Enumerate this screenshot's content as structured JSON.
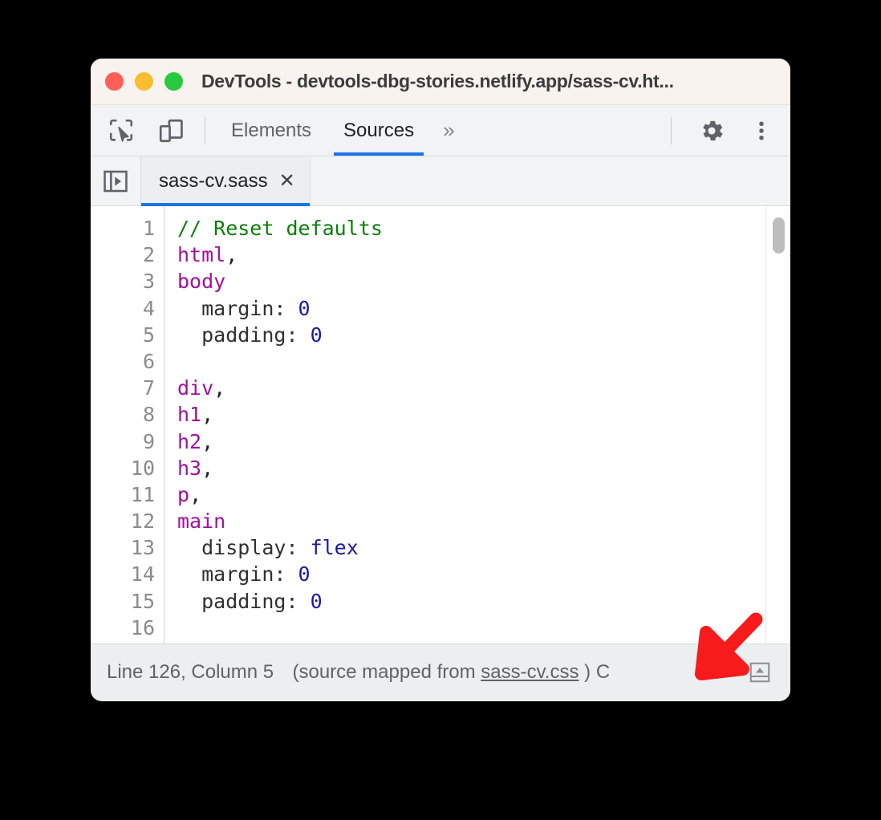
{
  "window": {
    "title": "DevTools - devtools-dbg-stories.netlify.app/sass-cv.ht...",
    "traffic_lights": [
      {
        "name": "close",
        "color": "#ff5f57"
      },
      {
        "name": "minimize",
        "color": "#f9bd2f"
      },
      {
        "name": "maximize",
        "color": "#27c93f"
      }
    ]
  },
  "toolbar": {
    "inspect_icon": "inspect-element-icon",
    "device_icon": "device-toolbar-icon",
    "panels": [
      {
        "label": "Elements",
        "active": false
      },
      {
        "label": "Sources",
        "active": true
      }
    ],
    "more_panels_label": "»",
    "settings_icon": "gear-icon",
    "menu_icon": "three-dot-menu-icon",
    "accent_color": "#1a73e8"
  },
  "tabstrip": {
    "navigator_icon": "show-navigator-icon",
    "open_files": [
      {
        "name": "sass-cv.sass",
        "active": true,
        "close_label": "✕"
      }
    ]
  },
  "editor": {
    "gutter_lines": [
      "1",
      "2",
      "3",
      "4",
      "5",
      "6",
      "7",
      "8",
      "9",
      "10",
      "11",
      "12",
      "13",
      "14",
      "15",
      "16"
    ],
    "lines": [
      {
        "n": "1",
        "tokens": [
          {
            "t": "// Reset defaults",
            "c": "tok-comment"
          }
        ]
      },
      {
        "n": "2",
        "tokens": [
          {
            "t": "html",
            "c": "tok-tag"
          },
          {
            "t": ",",
            "c": "tok-punc"
          }
        ]
      },
      {
        "n": "3",
        "tokens": [
          {
            "t": "body",
            "c": "tok-tag"
          }
        ]
      },
      {
        "n": "4",
        "tokens": [
          {
            "t": "  margin: ",
            "c": "tok-prop"
          },
          {
            "t": "0",
            "c": "tok-value"
          }
        ]
      },
      {
        "n": "5",
        "tokens": [
          {
            "t": "  padding: ",
            "c": "tok-prop"
          },
          {
            "t": "0",
            "c": "tok-value"
          }
        ]
      },
      {
        "n": "6",
        "tokens": [
          {
            "t": "",
            "c": "tok-plain"
          }
        ]
      },
      {
        "n": "7",
        "tokens": [
          {
            "t": "div",
            "c": "tok-tag"
          },
          {
            "t": ",",
            "c": "tok-punc"
          }
        ]
      },
      {
        "n": "8",
        "tokens": [
          {
            "t": "h1",
            "c": "tok-tag"
          },
          {
            "t": ",",
            "c": "tok-punc"
          }
        ]
      },
      {
        "n": "9",
        "tokens": [
          {
            "t": "h2",
            "c": "tok-tag"
          },
          {
            "t": ",",
            "c": "tok-punc"
          }
        ]
      },
      {
        "n": "10",
        "tokens": [
          {
            "t": "h3",
            "c": "tok-tag"
          },
          {
            "t": ",",
            "c": "tok-punc"
          }
        ]
      },
      {
        "n": "11",
        "tokens": [
          {
            "t": "p",
            "c": "tok-tag"
          },
          {
            "t": ",",
            "c": "tok-punc"
          }
        ]
      },
      {
        "n": "12",
        "tokens": [
          {
            "t": "main",
            "c": "tok-tag"
          }
        ]
      },
      {
        "n": "13",
        "tokens": [
          {
            "t": "  display: ",
            "c": "tok-prop"
          },
          {
            "t": "flex",
            "c": "tok-value"
          }
        ]
      },
      {
        "n": "14",
        "tokens": [
          {
            "t": "  margin: ",
            "c": "tok-prop"
          },
          {
            "t": "0",
            "c": "tok-value"
          }
        ]
      },
      {
        "n": "15",
        "tokens": [
          {
            "t": "  padding: ",
            "c": "tok-prop"
          },
          {
            "t": "0",
            "c": "tok-value"
          }
        ]
      },
      {
        "n": "16",
        "tokens": [
          {
            "t": "",
            "c": "tok-plain"
          }
        ]
      }
    ],
    "scrollbar": {
      "name": "vertical-scrollbar",
      "thumb_top_pct": 3
    }
  },
  "statusbar": {
    "prefix": "Line 126, Column 5",
    "source_mapped_prefix": "(source mapped from ",
    "source_link": "sass-cv.css",
    "source_mapped_suffix": ")",
    "trailing": " C",
    "prettyprint_icon": "pretty-print-icon"
  },
  "annotation": {
    "arrow": "red-arrow-pointing-down-left",
    "color": "#f71b1b"
  }
}
